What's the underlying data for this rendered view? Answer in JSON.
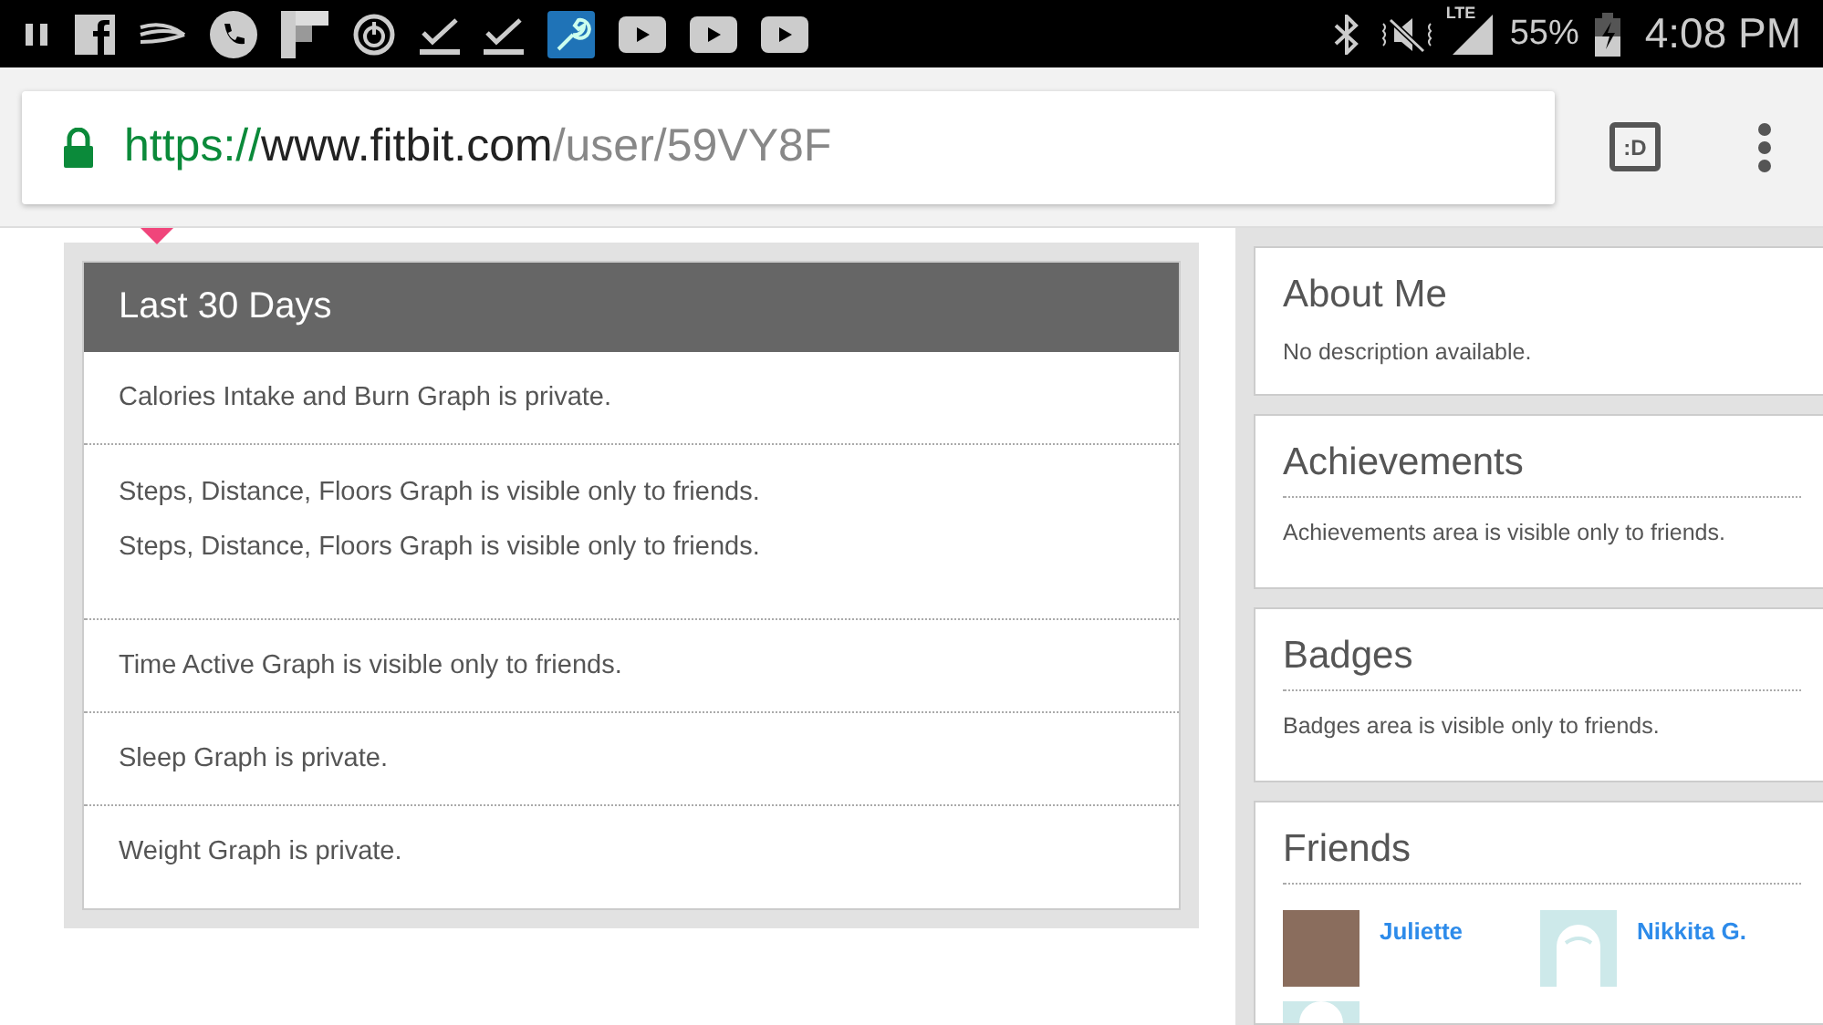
{
  "status_bar": {
    "network": "LTE",
    "battery": "55%",
    "time": "4:08 PM"
  },
  "address_bar": {
    "scheme": "https://",
    "host": "www.fitbit.com",
    "path": "/user/59VY8F",
    "tabs_label": ":D"
  },
  "last_30_days": {
    "title": "Last 30 Days",
    "rows": [
      {
        "lines": [
          "Calories Intake and Burn Graph is private."
        ]
      },
      {
        "lines": [
          "Steps, Distance, Floors Graph is visible only to friends.",
          "Steps, Distance, Floors Graph is visible only to friends."
        ]
      },
      {
        "lines": [
          "Time Active Graph is visible only to friends."
        ]
      },
      {
        "lines": [
          "Sleep Graph is private."
        ]
      },
      {
        "lines": [
          "Weight Graph is private."
        ]
      }
    ]
  },
  "sidebar": [
    {
      "kind": "about",
      "title": "About Me",
      "text": "No description available."
    },
    {
      "kind": "section",
      "title": "Achievements",
      "text": "Achievements area is visible only to friends."
    },
    {
      "kind": "section",
      "title": "Badges",
      "text": "Badges area is visible only to friends."
    },
    {
      "kind": "friends",
      "title": "Friends",
      "friends": [
        {
          "name": "Juliette",
          "photo": true
        },
        {
          "name": "Nikkita G.",
          "photo": false
        }
      ]
    }
  ]
}
